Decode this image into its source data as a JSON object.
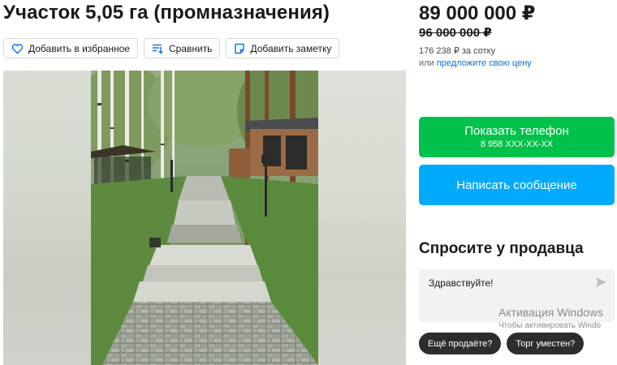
{
  "listing": {
    "title": "Участок 5,05 га (промназначения)",
    "price": "89 000 000 ₽",
    "old_price": "96 000 000 ₽",
    "price_per_sotka": "176 238 ₽ за сотку",
    "offer_prefix": "или",
    "offer_link": "предложите свою цену"
  },
  "actions": [
    {
      "label": "Добавить в избранное",
      "icon": "heart-icon"
    },
    {
      "label": "Сравнить",
      "icon": "compare-icon"
    },
    {
      "label": "Добавить заметку",
      "icon": "note-icon"
    }
  ],
  "contact": {
    "phone_label": "Показать телефон",
    "phone_masked": "8 958 XXX-XX-XX",
    "message_label": "Написать сообщение"
  },
  "ask": {
    "title": "Спросите у продавца",
    "message": "Здравствуйте!",
    "send_icon": "send-icon",
    "chips": [
      "Ещё продаёте?",
      "Торг уместен?"
    ]
  },
  "watermark": {
    "line1": "Активация Windows",
    "line2": "Чтобы активировать Windo"
  },
  "colors": {
    "phone_button": "#00c24a",
    "message_button": "#00aaff",
    "link": "#0a70e0",
    "chip": "#2d2d2d"
  }
}
